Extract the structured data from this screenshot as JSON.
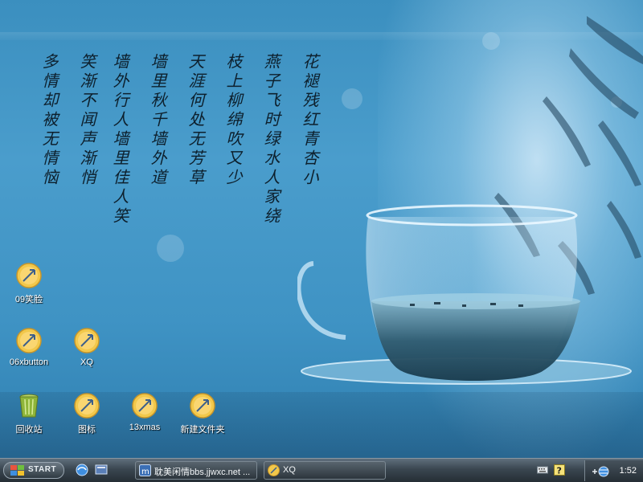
{
  "desktop": {
    "poem_columns": [
      "花褪残红青杏小",
      "燕子飞时绿水人家绕",
      "枝上柳绵吹又少",
      "天涯何处无芳草",
      "墙里秋千墙外道",
      "墙外行人墙里佳人笑",
      "笑渐不闻声渐悄",
      "多情却被无情恼"
    ],
    "icons": [
      {
        "label": "09笑脸",
        "icon": "folder-shortcut-icon"
      },
      {
        "label": "06xbutton",
        "icon": "folder-shortcut-icon"
      },
      {
        "label": "XQ",
        "icon": "folder-shortcut-icon"
      },
      {
        "label": "回收站",
        "icon": "recycle-bin-icon"
      },
      {
        "label": "图标",
        "icon": "folder-shortcut-icon"
      },
      {
        "label": "13xmas",
        "icon": "folder-shortcut-icon"
      },
      {
        "label": "新建文件夹",
        "icon": "folder-shortcut-icon"
      }
    ]
  },
  "taskbar": {
    "start_label": "START",
    "quick_launch": [
      "browser-icon",
      "show-desktop-icon"
    ],
    "tasks": [
      {
        "label": "耽美闲情bbs.jjwxc.net ...",
        "icon": "browser-window-icon"
      },
      {
        "label": "XQ",
        "icon": "folder-window-icon"
      }
    ],
    "tray_icons": [
      "keyboard-icon",
      "help-icon",
      "expand-tray-icon",
      "network-icon"
    ],
    "clock": "1:52"
  },
  "colors": {
    "desktop_blue": "#4a9dcc",
    "taskbar_dark": "#2c353c",
    "icon_gold": "#f2c84b"
  }
}
